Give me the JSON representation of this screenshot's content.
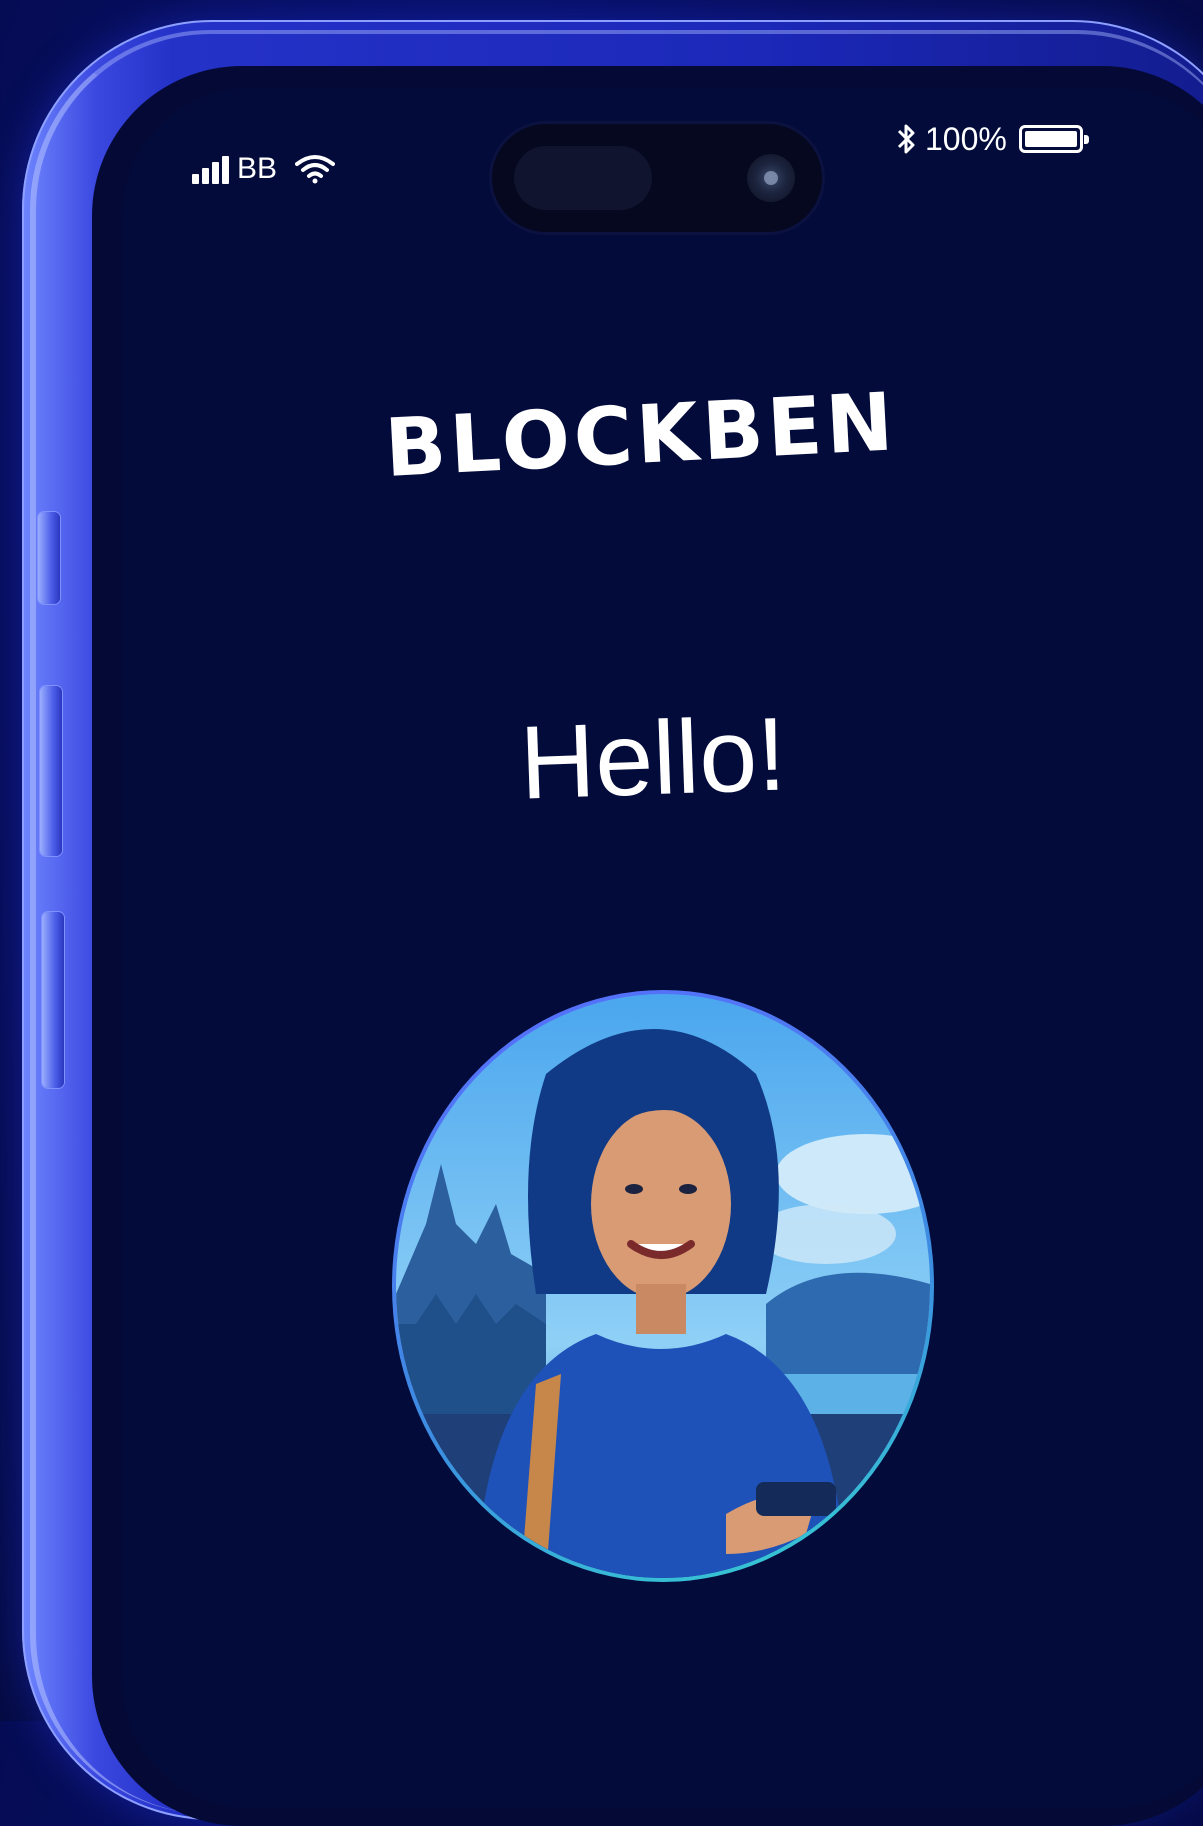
{
  "status_bar": {
    "carrier": "BB",
    "battery_percent": "100%",
    "battery_level": 1.0
  },
  "app": {
    "brand": "BLOCKBEN",
    "greeting": "Hello!"
  },
  "avatar": {
    "icon": "profile-avatar"
  },
  "colors": {
    "background": "#060d5a",
    "screen": "#030b3b",
    "frame": "#2532c8",
    "text": "#ffffff",
    "avatar_ring_end": "#35d4d0"
  }
}
